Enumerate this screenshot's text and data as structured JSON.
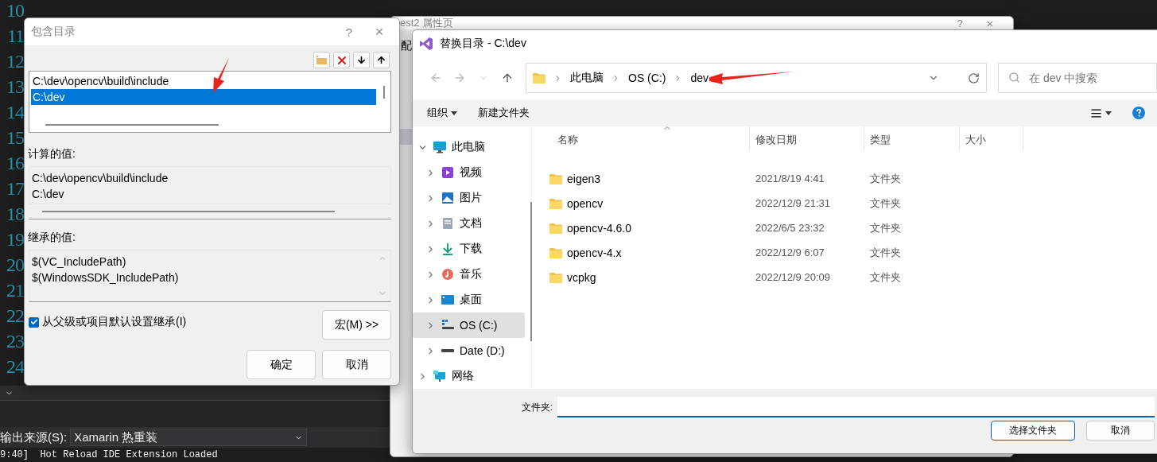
{
  "editor": {
    "line_numbers": [
      "10",
      "11",
      "12",
      "13",
      "14",
      "15",
      "16",
      "17",
      "18",
      "19",
      "20",
      "21",
      "22",
      "23",
      "24"
    ]
  },
  "output_panel": {
    "source_label": "输出来源(S):",
    "source_value": "Xamarin 热重装",
    "log_line": "9:40]  Hot Reload IDE Extension Loaded"
  },
  "background_window": {
    "title": "est2 属性页",
    "help": "?",
    "close": "×",
    "tab_fragment": "配"
  },
  "include_dialog": {
    "title": "包含目录",
    "help": "?",
    "close": "×",
    "entries": [
      {
        "text": "C:\\dev\\opencv\\build\\include",
        "selected": false
      },
      {
        "text": "C:\\dev",
        "selected": true
      }
    ],
    "evaluated_label": "计算的值:",
    "evaluated_values": [
      "C:\\dev\\opencv\\build\\include",
      "C:\\dev"
    ],
    "inherited_label": "继承的值:",
    "inherited_values": [
      "$(VC_IncludePath)",
      "$(WindowsSDK_IncludePath)"
    ],
    "inherit_checkbox": {
      "label": "从父级或项目默认设置继承(I)",
      "checked": true
    },
    "macros_button": "宏(M) >>",
    "ok_button": "确定",
    "cancel_button": "取消"
  },
  "folder_dialog": {
    "title": "替换目录 - C:\\dev",
    "breadcrumbs": [
      "此电脑",
      "OS (C:)",
      "dev"
    ],
    "search": {
      "placeholder": "在 dev 中搜索"
    },
    "toolbar": {
      "organize": "组织",
      "new_folder": "新建文件夹"
    },
    "nav_tree": [
      {
        "label": "此电脑",
        "kind": "computer",
        "expanded": true,
        "selected": false,
        "children": [
          {
            "label": "视频",
            "kind": "video",
            "expanded": false,
            "selected": false
          },
          {
            "label": "图片",
            "kind": "pictures",
            "expanded": false,
            "selected": false
          },
          {
            "label": "文档",
            "kind": "documents",
            "expanded": false,
            "selected": false
          },
          {
            "label": "下载",
            "kind": "downloads",
            "expanded": false,
            "selected": false
          },
          {
            "label": "音乐",
            "kind": "music",
            "expanded": false,
            "selected": false
          },
          {
            "label": "桌面",
            "kind": "desktop",
            "expanded": false,
            "selected": false
          },
          {
            "label": "OS (C:)",
            "kind": "system-drive",
            "expanded": false,
            "selected": true
          },
          {
            "label": "Date (D:)",
            "kind": "drive",
            "expanded": false,
            "selected": false
          }
        ]
      },
      {
        "label": "网络",
        "kind": "network",
        "expanded": false,
        "selected": false
      }
    ],
    "columns": [
      "名称",
      "修改日期",
      "类型",
      "大小"
    ],
    "files": [
      {
        "name": "eigen3",
        "modified": "2021/8/19 4:41",
        "type": "文件夹"
      },
      {
        "name": "opencv",
        "modified": "2022/12/9 21:31",
        "type": "文件夹"
      },
      {
        "name": "opencv-4.6.0",
        "modified": "2022/6/5 23:32",
        "type": "文件夹"
      },
      {
        "name": "opencv-4.x",
        "modified": "2022/12/9 6:07",
        "type": "文件夹"
      },
      {
        "name": "vcpkg",
        "modified": "2022/12/9 20:09",
        "type": "文件夹"
      }
    ],
    "folder_label": "文件夹:",
    "select_button": "选择文件夹",
    "cancel_button": "取消"
  }
}
